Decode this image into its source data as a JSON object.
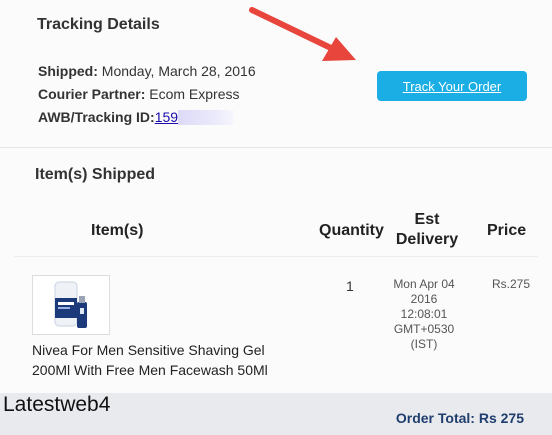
{
  "tracking": {
    "title": "Tracking Details",
    "shipped_label": "Shipped:",
    "shipped_value": "Monday, March 28, 2016",
    "courier_label": "Courier Partner:",
    "courier_value": "Ecom Express",
    "awb_label": "AWB/Tracking ID:",
    "awb_value": "159",
    "track_button": "Track Your Order"
  },
  "items_section": {
    "title": "Item(s) Shipped",
    "headers": {
      "items": "Item(s)",
      "quantity": "Quantity",
      "est_delivery_line1": "Est",
      "est_delivery_line2": "Delivery",
      "price": "Price"
    },
    "rows": [
      {
        "name_line1": "Nivea For Men Sensitive Shaving Gel",
        "name_line2": "200Ml With Free Men Facewash 50Ml",
        "quantity": "1",
        "delivery_lines": [
          "Mon Apr 04",
          "2016",
          "12:08:01",
          "GMT+0530",
          "(IST)"
        ],
        "price": "Rs.275"
      }
    ]
  },
  "footer": {
    "watermark": "Latestweb4",
    "order_total": "Order Total: Rs 275"
  },
  "colors": {
    "button": "#1aaee4",
    "arrow": "#e8453c",
    "total_text": "#1f3e6e"
  }
}
